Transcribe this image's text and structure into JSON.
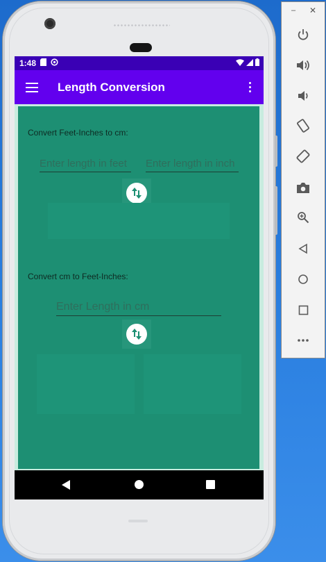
{
  "status_bar": {
    "time": "1:48"
  },
  "app_bar": {
    "title": "Length Conversion"
  },
  "section1": {
    "label": "Convert Feet-Inches to cm:",
    "feet_placeholder": "Enter length in feet",
    "inch_placeholder": "Enter length in inch"
  },
  "section2": {
    "label": "Convert cm to Feet-Inches:",
    "cm_placeholder": "Enter Length in cm"
  },
  "emulator_toolbar": {
    "minimize": "–",
    "close": "✕",
    "icons": [
      "power-icon",
      "volume-up-icon",
      "volume-down-icon",
      "rotate-left-icon",
      "rotate-right-icon",
      "camera-icon",
      "zoom-icon",
      "back-icon",
      "home-icon",
      "overview-icon",
      "more-icon"
    ]
  },
  "colors": {
    "status_bar": "#3a00b5",
    "app_bar": "#6200ee",
    "panel": "#1d8f73",
    "panel_border": "#c8ecdf"
  }
}
